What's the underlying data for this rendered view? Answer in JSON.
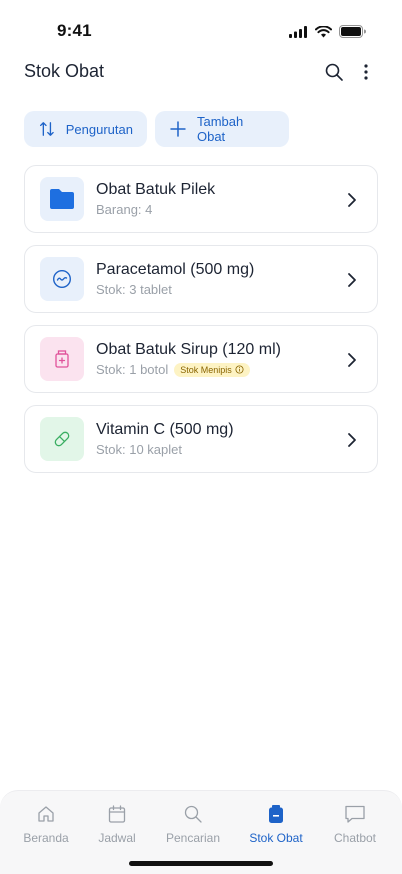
{
  "status_bar": {
    "time": "9:41"
  },
  "header": {
    "title": "Stok Obat"
  },
  "actions": {
    "sort_label": "Pengurutan",
    "add_label": "Tambah Obat"
  },
  "items": [
    {
      "title": "Obat Batuk Pilek",
      "subtitle": "Barang: 4",
      "icon": "folder-icon",
      "icon_color": "#1e6fe0",
      "bg": "#e8f0fb"
    },
    {
      "title": "Paracetamol (500 mg)",
      "subtitle": "Stok: 3 tablet",
      "icon": "tablet-icon",
      "icon_color": "#1e63c8",
      "bg": "#e8f0fb"
    },
    {
      "title": "Obat Batuk Sirup (120 ml)",
      "subtitle": "Stok: 1 botol",
      "badge": "Stok Menipis",
      "icon": "syrup-bottle-icon",
      "icon_color": "#e0529a",
      "bg": "#fbe3ef"
    },
    {
      "title": "Vitamin C (500 mg)",
      "subtitle": "Stok: 10 kaplet",
      "icon": "capsule-icon",
      "icon_color": "#3aae62",
      "bg": "#e2f6e8"
    }
  ],
  "tabs": [
    {
      "label": "Beranda",
      "icon": "home-icon",
      "active": false
    },
    {
      "label": "Jadwal",
      "icon": "calendar-icon",
      "active": false
    },
    {
      "label": "Pencarian",
      "icon": "search-icon",
      "active": false
    },
    {
      "label": "Stok Obat",
      "icon": "medicine-box-icon",
      "active": true
    },
    {
      "label": "Chatbot",
      "icon": "chat-icon",
      "active": false
    }
  ],
  "colors": {
    "accent": "#1e63c8",
    "chip_bg": "#e8f0fb",
    "badge_bg": "#fdf3c4",
    "muted": "#9aa0a8"
  }
}
